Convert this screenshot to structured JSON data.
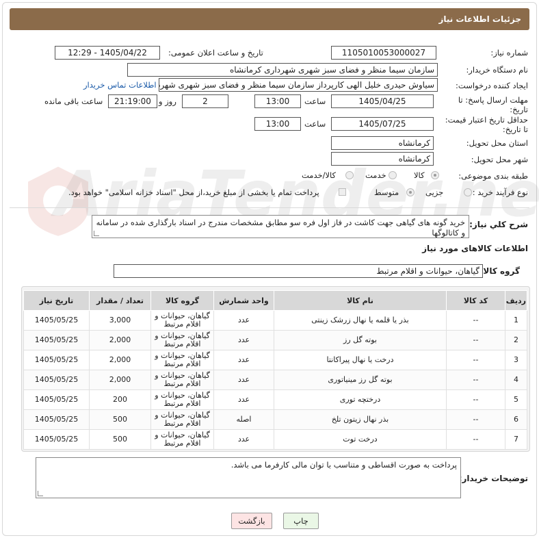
{
  "header": {
    "title": "جزئیات اطلاعات نیاز"
  },
  "form": {
    "need_number": {
      "label": "شماره نیاز:",
      "value": "1105010053000027"
    },
    "announce_datetime": {
      "label": "تاریخ و ساعت اعلان عمومی:",
      "value": "1405/04/22 - 12:29"
    },
    "buyer_org": {
      "label": "نام دستگاه خریدار:",
      "value": "سازمان سیما منظر و فضای سبز شهری شهرداری کرمانشاه"
    },
    "creator": {
      "label": "ایجاد کننده درخواست:",
      "value": "سیاوش حیدری خلیل الهی کارپرداز سازمان سیما منظر و فضای سبز شهری شهرداری کرمانشاه",
      "contact_link": "اطلاعات تماس خریدار"
    },
    "deadline": {
      "label": "مهلت ارسال پاسخ: تا تاریخ:",
      "date": "1405/04/25",
      "time_label": "ساعت",
      "time": "13:00",
      "days": "2",
      "days_label": "روز و",
      "remaining": "21:19:00",
      "remaining_label": "ساعت باقی مانده"
    },
    "price_validity": {
      "label": "حداقل تاریخ اعتبار قیمت: تا تاریخ:",
      "date": "1405/07/25",
      "time_label": "ساعت",
      "time": "13:00"
    },
    "province": {
      "label": "استان محل تحویل:",
      "value": "کرمانشاه"
    },
    "city": {
      "label": "شهر محل تحویل:",
      "value": "کرمانشاه"
    },
    "category": {
      "label": "طبقه بندی موضوعی:",
      "options": [
        "کالا",
        "خدمت",
        "کالا/خدمت"
      ],
      "selected": "کالا"
    },
    "purchase_type": {
      "label": "نوع فرآیند خرید :",
      "options": [
        "جزیی",
        "متوسط"
      ],
      "selected": "متوسط",
      "treasury_note": "پرداخت تمام یا بخشی از مبلغ خرید،از محل \"اسناد خزانه اسلامی\" خواهد بود."
    }
  },
  "description": {
    "label": "شرح کلي نياز:",
    "text": "خرید گونه های گیاهی جهت کاشت در فاز اول فره سو مطابق مشخصات مندرج در اسناد بارگذاری شده در سامانه و کاتالوگها"
  },
  "goods_section": {
    "title": "اطلاعات کالاهای مورد نیاز",
    "group_label": "گروه کالا:",
    "group_value": "گیاهان، حیوانات و اقلام مرتبط"
  },
  "table": {
    "columns": [
      "ردیف",
      "کد کالا",
      "نام کالا",
      "واحد شمارش",
      "گروه کالا",
      "تعداد / مقدار",
      "تاریخ نیاز"
    ],
    "rows": [
      [
        "1",
        "--",
        "بذر یا قلمه یا نهال زرشک زینتی",
        "عدد",
        "گیاهان، حیوانات و اقلام مرتبط",
        "3,000",
        "1405/05/25"
      ],
      [
        "2",
        "--",
        "بوته گل رز",
        "عدد",
        "گیاهان، حیوانات و اقلام مرتبط",
        "2,000",
        "1405/05/25"
      ],
      [
        "3",
        "--",
        "درخت یا نهال پیراکانتا",
        "عدد",
        "گیاهان، حیوانات و اقلام مرتبط",
        "2,000",
        "1405/05/25"
      ],
      [
        "4",
        "--",
        "بوته گل رز مینیاتوری",
        "عدد",
        "گیاهان، حیوانات و اقلام مرتبط",
        "2,000",
        "1405/05/25"
      ],
      [
        "5",
        "--",
        "درختچه توری",
        "عدد",
        "گیاهان، حیوانات و اقلام مرتبط",
        "200",
        "1405/05/25"
      ],
      [
        "6",
        "--",
        "بذر نهال زیتون تلخ",
        "اصله",
        "گیاهان، حیوانات و اقلام مرتبط",
        "500",
        "1405/05/25"
      ],
      [
        "7",
        "--",
        "درخت توت",
        "عدد",
        "گیاهان، حیوانات و اقلام مرتبط",
        "500",
        "1405/05/25"
      ]
    ]
  },
  "buyer_notes": {
    "label": "توضیحات خریدار:",
    "text": "پرداخت به صورت اقساطی و متناسب با توان مالی کارفرما می باشد."
  },
  "buttons": {
    "print": "چاپ",
    "back": "بازگشت"
  },
  "watermark": {
    "text": "AriaTender.neT"
  },
  "colors": {
    "header_bg": "#8b6b4a",
    "link": "#1a5aa8",
    "print_bg": "#eaf7e6",
    "back_bg": "#fde4e4"
  }
}
